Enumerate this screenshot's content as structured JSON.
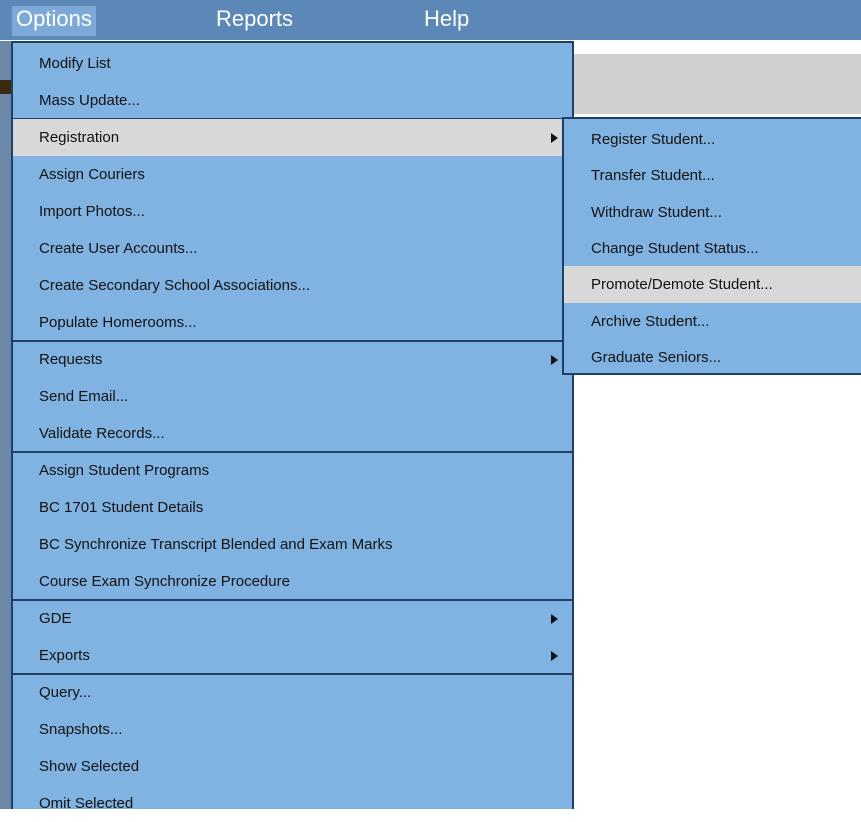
{
  "menubar": {
    "items": [
      {
        "label": "Options",
        "active": true
      },
      {
        "label": "Reports",
        "active": false
      },
      {
        "label": "Help",
        "active": false
      }
    ]
  },
  "options_menu": {
    "groups": [
      [
        {
          "label": "Modify List"
        },
        {
          "label": "Mass Update..."
        }
      ],
      [
        {
          "label": "Registration",
          "submenu": true,
          "highlighted": true
        },
        {
          "label": "Assign Couriers"
        },
        {
          "label": "Import Photos..."
        },
        {
          "label": "Create User Accounts..."
        },
        {
          "label": "Create Secondary School Associations..."
        },
        {
          "label": "Populate Homerooms..."
        }
      ],
      [
        {
          "label": "Requests",
          "submenu": true
        },
        {
          "label": "Send Email..."
        },
        {
          "label": "Validate Records..."
        }
      ],
      [
        {
          "label": "Assign Student Programs"
        },
        {
          "label": "BC 1701 Student Details"
        },
        {
          "label": "BC Synchronize Transcript Blended and Exam Marks"
        },
        {
          "label": "Course Exam Synchronize Procedure"
        }
      ],
      [
        {
          "label": "GDE",
          "submenu": true
        },
        {
          "label": "Exports",
          "submenu": true
        }
      ],
      [
        {
          "label": "Query..."
        },
        {
          "label": "Snapshots..."
        },
        {
          "label": "Show Selected"
        },
        {
          "label": "Omit Selected"
        }
      ]
    ]
  },
  "registration_submenu": {
    "items": [
      {
        "label": "Register Student..."
      },
      {
        "label": "Transfer Student..."
      },
      {
        "label": "Withdraw Student..."
      },
      {
        "label": "Change Student Status..."
      },
      {
        "label": "Promote/Demote Student...",
        "highlighted": true
      },
      {
        "label": "Archive Student..."
      },
      {
        "label": "Graduate Seniors..."
      }
    ]
  },
  "colors": {
    "menubar_bg": "#5b88b6",
    "menu_bg": "#80b2e2",
    "highlight_bg": "#d8d8d8",
    "border": "#1e3f66"
  },
  "icons": {
    "submenu_arrow": "submenu-arrow-icon"
  }
}
